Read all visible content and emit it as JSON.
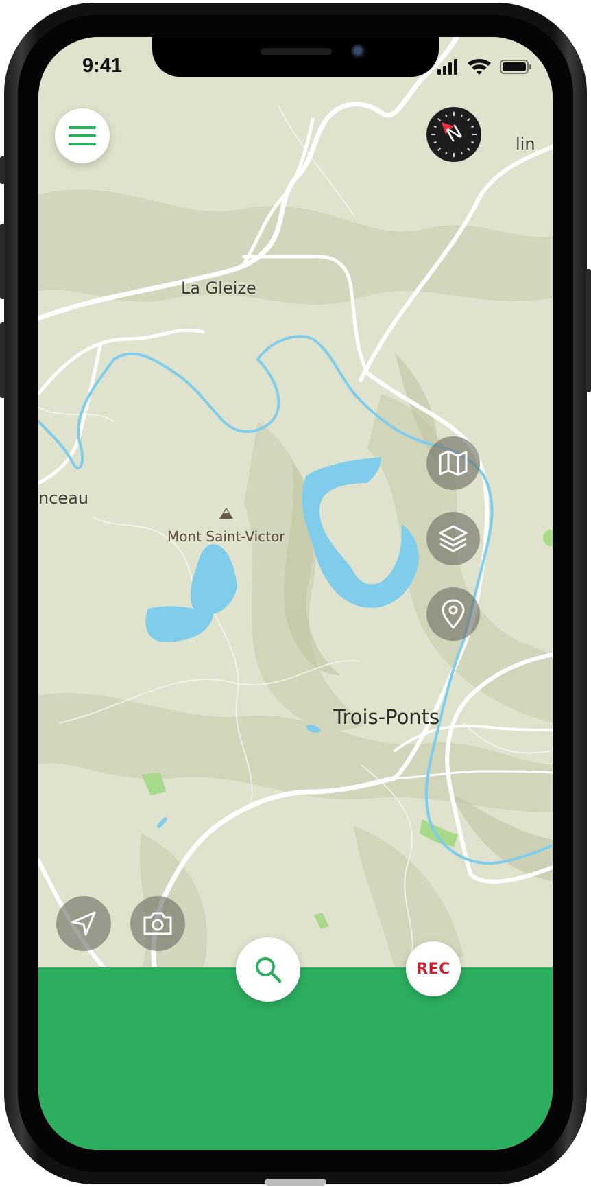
{
  "status_bar": {
    "time": "9:41"
  },
  "map": {
    "labels": {
      "la_gleize": "La Gleize",
      "peak": "Mont Saint-Victor",
      "town_left": "nceau",
      "trois_ponts": "Trois-Ponts",
      "town_top_right": "lin"
    }
  },
  "controls": {
    "menu_icon": "hamburger-icon",
    "compass_letter": "N",
    "map_layers": [
      "map-icon",
      "layers-icon",
      "pin-icon"
    ],
    "navigate_icon": "navigation-arrow-icon",
    "camera_icon": "camera-icon",
    "search_icon": "search-icon",
    "rec_label": "REC"
  },
  "colors": {
    "accent_green": "#2cae5f",
    "rec_red": "#d0202c",
    "water": "#7fcdea",
    "land": "#dfe2cc",
    "road": "#ffffff"
  }
}
